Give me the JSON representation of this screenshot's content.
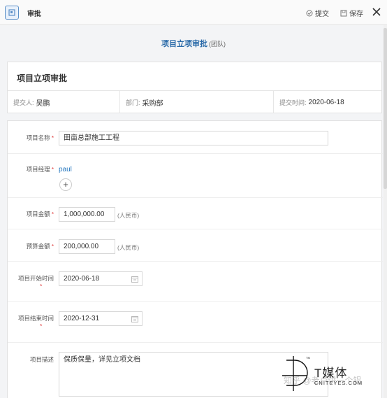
{
  "topbar": {
    "title": "审批",
    "submit_label": "提交",
    "save_label": "保存"
  },
  "page": {
    "title": "项目立项审批",
    "subtitle": "(团队)"
  },
  "info": {
    "heading": "项目立项审批",
    "submitter_label": "提交人:",
    "submitter": "吴鹏",
    "dept_label": "部门:",
    "dept": "采购部",
    "time_label": "提交时间:",
    "time": "2020-06-18"
  },
  "form": {
    "name_label": "项目名称",
    "name_value": "田亩总部施工工程",
    "manager_label": "项目经理",
    "manager_value": "paul",
    "add_label": "+",
    "amount_label": "项目金额",
    "amount_value": "1,000,000.00",
    "amount_unit": "(人民币)",
    "budget_label": "预算金额",
    "budget_value": "200,000.00",
    "budget_unit": "(人民币)",
    "start_label": "项目开始时间",
    "start_value": "2020-06-18",
    "end_label": "项目结束时间",
    "end_value": "2020-12-31",
    "desc_label": "项目描述",
    "desc_value": "保质保量，详见立项文档",
    "required_mark": "*"
  },
  "watermark": {
    "brand": "T媒体",
    "domain": "CNITEYES.COM",
    "faint": "知乎 @老卢讲一个铝"
  },
  "colors": {
    "accent": "#2a6aa8",
    "required": "#e04040",
    "link": "#2a7ac0"
  },
  "icons": [
    "app-icon",
    "submit-icon",
    "save-icon",
    "close-icon",
    "calendar-icon",
    "plus-icon"
  ]
}
